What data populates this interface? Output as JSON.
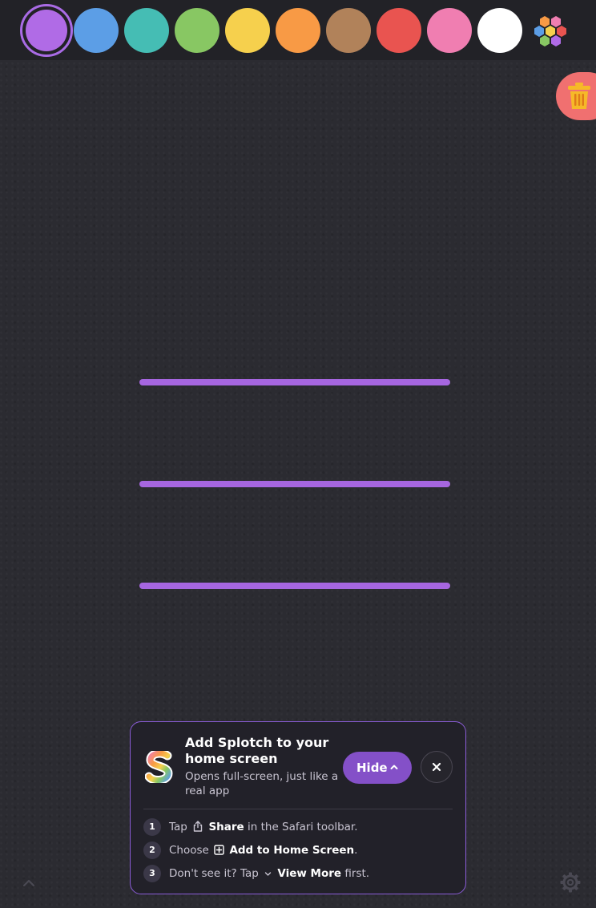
{
  "palette": {
    "colors": [
      {
        "name": "purple",
        "hex": "#b06be6",
        "selected": true
      },
      {
        "name": "blue",
        "hex": "#5c9ee6"
      },
      {
        "name": "teal",
        "hex": "#45bdb4"
      },
      {
        "name": "green",
        "hex": "#88c763"
      },
      {
        "name": "yellow",
        "hex": "#f6d04d"
      },
      {
        "name": "orange",
        "hex": "#f89a45"
      },
      {
        "name": "brown",
        "hex": "#b1825a"
      },
      {
        "name": "red",
        "hex": "#e95450"
      },
      {
        "name": "pink",
        "hex": "#f07eb1"
      },
      {
        "name": "white",
        "hex": "#ffffff"
      }
    ],
    "more_icon": "hexagon-palette-icon"
  },
  "canvas": {
    "stroke_color": "#a666e0",
    "trash_icon": "trash-icon"
  },
  "install_prompt": {
    "title": "Add Splotch to your home screen",
    "subtitle": "Opens full-screen, just like a real app",
    "hide_label": "Hide",
    "close_icon": "close-icon",
    "steps": [
      {
        "num": "1",
        "pre": "Tap",
        "bold": "Share",
        "post": "in the Safari toolbar.",
        "icon": "share-icon"
      },
      {
        "num": "2",
        "pre": "Choose",
        "bold": "Add to Home Screen",
        "post": ".",
        "icon": "add-square-icon"
      },
      {
        "num": "3",
        "pre": "Don't see it? Tap",
        "bold": "View More",
        "post": "first.",
        "icon": "chevron-down-icon"
      }
    ]
  },
  "footer": {
    "collapse_icon": "chevron-up-icon",
    "settings_icon": "gear-icon"
  }
}
